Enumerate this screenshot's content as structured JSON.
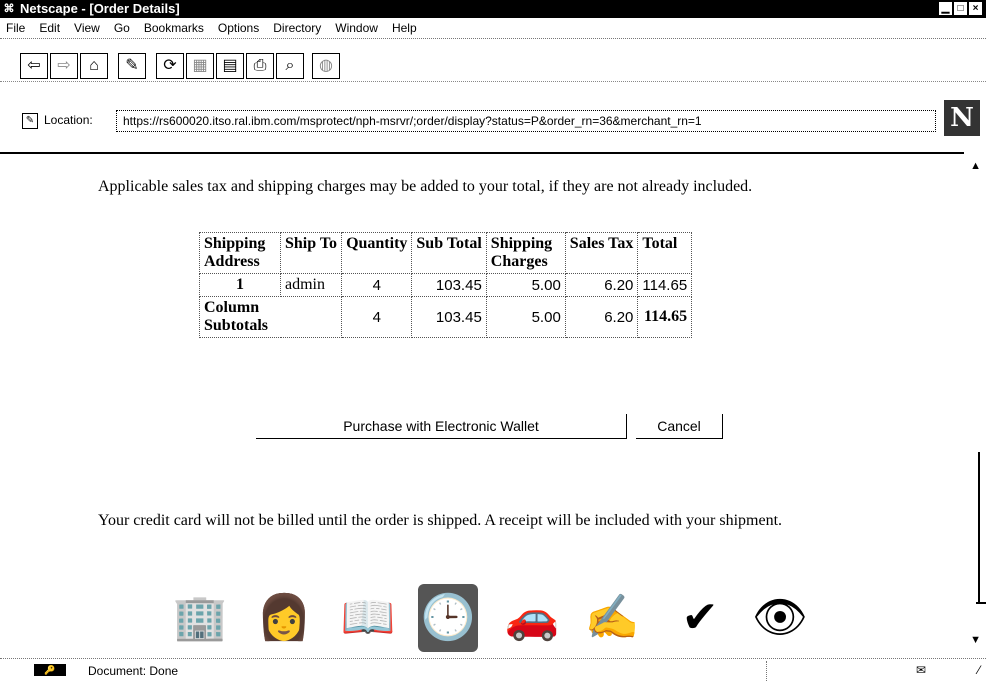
{
  "window": {
    "title": "Netscape - [Order Details]",
    "sys_glyph": "⌘",
    "min": "▁",
    "max": "□",
    "close": "×"
  },
  "menu": [
    "File",
    "Edit",
    "View",
    "Go",
    "Bookmarks",
    "Options",
    "Directory",
    "Window",
    "Help"
  ],
  "toolbar": {
    "back": "⇦",
    "forward": "⇨",
    "home": "⌂",
    "edit": "✎",
    "reload": "⟳",
    "images": "▦",
    "open": "▤",
    "print": "⎙",
    "find": "⌕",
    "stop": "◍"
  },
  "location": {
    "icon": "✎",
    "label": "Location:",
    "url": "https://rs600020.itso.ral.ibm.com/msprotect/nph-msrvr/;order/display?status=P&order_rn=36&merchant_rn=1",
    "dropdown": "▾",
    "logo": "N"
  },
  "content": {
    "tax_notice": "Applicable sales tax and shipping charges may be added to your total, if they are not already included.",
    "table": {
      "headers": [
        "Shipping Address",
        "Ship To",
        "Quantity",
        "Sub Total",
        "Shipping Charges",
        "Sales Tax",
        "Total"
      ],
      "row": {
        "address": "1",
        "ship_to": "admin",
        "quantity": "4",
        "sub_total": "103.45",
        "shipping": "5.00",
        "sales_tax": "6.20",
        "total": "114.65"
      },
      "subtotal": {
        "label": "Column Subtotals",
        "quantity": "4",
        "sub_total": "103.45",
        "shipping": "5.00",
        "sales_tax": "6.20",
        "total": "114.65"
      }
    },
    "purchase_button": "Purchase with Electronic Wallet",
    "cancel_button": "Cancel",
    "billing_notice": "Your credit card will not be billed until the order is shipped. A receipt will be included with your shipment."
  },
  "process_icons": {
    "i1": "🏢",
    "i2": "👩",
    "i3": "📖",
    "i4": "🕒",
    "i5": "🚗",
    "i6": "✍",
    "i7": "✔",
    "i8": "👁"
  },
  "scrollbar": {
    "up": "▲",
    "down": "▼"
  },
  "status": {
    "key_icon": "🔑",
    "text": "Document: Done",
    "mail": "✉",
    "grip": "⁄"
  }
}
